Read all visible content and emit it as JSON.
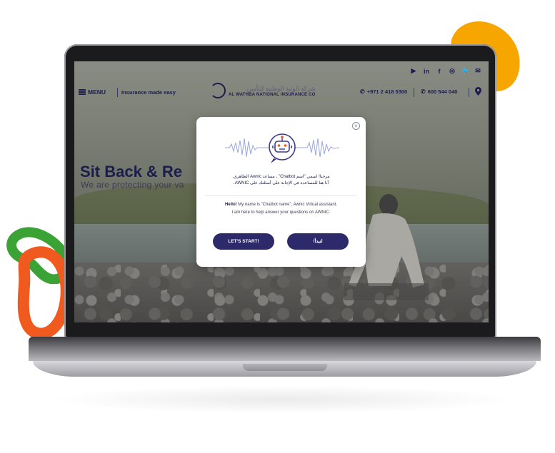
{
  "site": {
    "menu_label": "MENU",
    "tagline": "Insurance made easy",
    "logo_ar": "شركة الوثبة الوطنية للتأمين",
    "logo_en": "AL WATHBA NATIONAL INSURANCE CO",
    "phone_whatsapp": "+971 2 418 5300",
    "phone_toll_free": "600 544 040",
    "social_icons": [
      "youtube-icon",
      "linkedin-icon",
      "facebook-icon",
      "instagram-icon",
      "twitter-icon",
      "email-icon"
    ],
    "social_glyphs": [
      "▶",
      "in",
      "f",
      "◎",
      "🐦",
      "✉"
    ]
  },
  "hero": {
    "title": "Sit Back & Re",
    "subtitle": "We are protecting your va"
  },
  "chatbot": {
    "message_ar_line1": "مرحبا! اسمي \"اسم Chatbot\" ، مساعد Awnic الظاهري.",
    "message_ar_line2": "أنا هنا للمساعدة في الإجابة على أسئلتك على AWNIC.",
    "message_en_hello": "Hello!",
    "message_en_line1": " My name is \"Chatbot name\", Awnic Virtual assistant.",
    "message_en_line2": "I am here to help answer your questions on AWNIC.",
    "start_button": "LET'S START!",
    "start_button_ar": "لنبدأ!",
    "close_symbol": "×"
  },
  "colors": {
    "brand_navy": "#2c2a6b",
    "text_navy": "#1d1d4d",
    "accent_yellow": "#f7a600",
    "accent_orange": "#f05a1e",
    "accent_green": "#3ba335"
  }
}
